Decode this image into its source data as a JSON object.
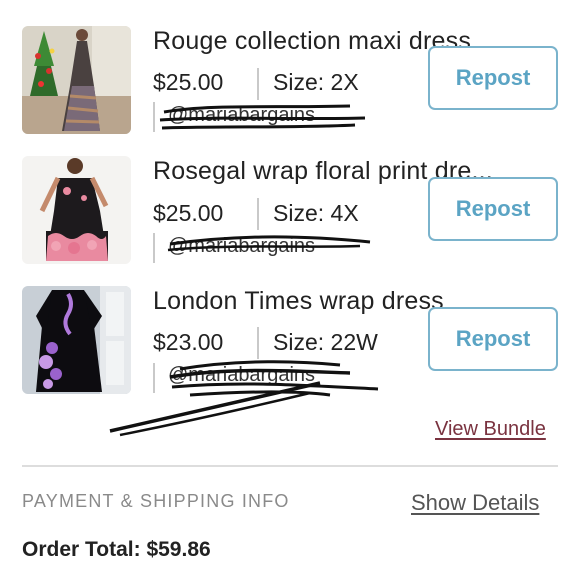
{
  "items": [
    {
      "title": "Rouge collection maxi dress",
      "price": "$25.00",
      "size": "Size: 2X",
      "seller": "@mariabargains",
      "repost_label": "Repost",
      "thumbnail_icon": "maxi-dress-photo"
    },
    {
      "title": "Rosegal wrap floral print dre...",
      "price": "$25.00",
      "size": "Size: 4X",
      "seller": "@mariabargains",
      "repost_label": "Repost",
      "thumbnail_icon": "floral-wrap-dress-photo"
    },
    {
      "title": "London Times wrap dress",
      "price": "$23.00",
      "size": "Size: 22W",
      "seller": "@mariabargains",
      "repost_label": "Repost",
      "thumbnail_icon": "black-wrap-dress-photo"
    }
  ],
  "bundle": {
    "view_label": "View Bundle"
  },
  "payment": {
    "heading": "PAYMENT & SHIPPING INFO",
    "show_details_label": "Show Details",
    "order_total": "Order Total: $59.86"
  },
  "colors": {
    "accent": "#5ba4c4",
    "link": "#7a3340",
    "muted": "#8a8a8a"
  }
}
